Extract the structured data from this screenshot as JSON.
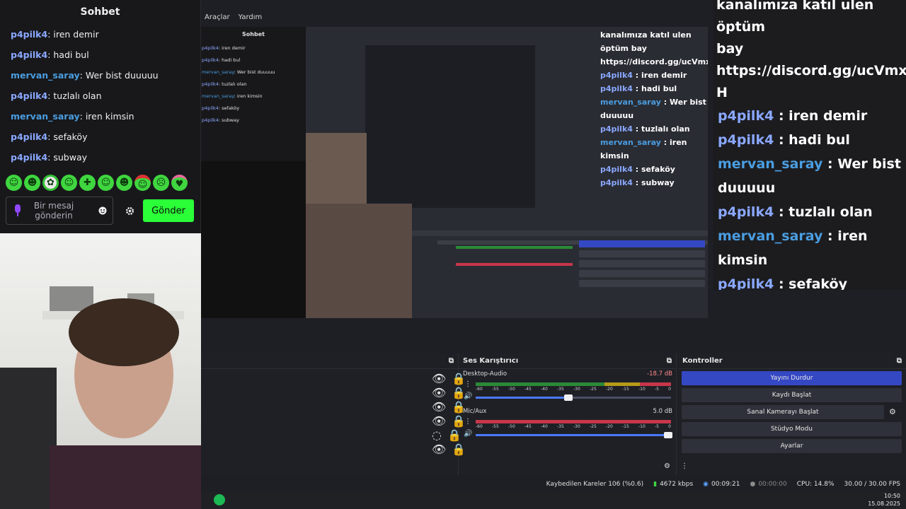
{
  "chat": {
    "title": "Sohbet",
    "user_colors": {
      "p4pilk4": "#8aa8ff",
      "mervan_saray": "#4a9de0"
    },
    "messages": [
      {
        "user": "p4pilk4",
        "text": "iren demir"
      },
      {
        "user": "p4pilk4",
        "text": "hadi bul"
      },
      {
        "user": "mervan_saray",
        "text": "Wer bist duuuuu"
      },
      {
        "user": "p4pilk4",
        "text": "tuzlalı olan"
      },
      {
        "user": "mervan_saray",
        "text": "iren kimsin"
      },
      {
        "user": "p4pilk4",
        "text": "sefaköy"
      },
      {
        "user": "p4pilk4",
        "text": "subway"
      }
    ],
    "placeholder": "Bir mesaj gönderin",
    "send_label": "Gönder",
    "accent": "#2bff38"
  },
  "menubar": {
    "items": [
      "Araçlar",
      "Yardım"
    ]
  },
  "preview": {
    "chat_title": "Sohbet",
    "overlay_intro": "kanalımıza katıl ulen öptüm bay https://discord.gg/ucVmxvhH"
  },
  "overlay": {
    "intro_lines": [
      "kanalımıza katıl ulen öptüm",
      "bay",
      "https://discord.gg/ucVmxvh",
      "H"
    ],
    "messages": [
      {
        "user": "p4pilk4",
        "text": ": iren demir"
      },
      {
        "user": "p4pilk4",
        "text": ": hadi bul"
      },
      {
        "user": "mervan_saray",
        "text": ": Wer bist duuuuu"
      },
      {
        "user": "p4pilk4",
        "text": ": tuzlalı olan"
      },
      {
        "user": "mervan_saray",
        "text": ": iren kimsin"
      },
      {
        "user": "p4pilk4",
        "text": ": sefaköy"
      },
      {
        "user": "p4pilk4",
        "text": ": subway"
      }
    ]
  },
  "mixer": {
    "title": "Ses Karıştırıcı",
    "scale": [
      "-60",
      "-55",
      "-50",
      "-45",
      "-40",
      "-35",
      "-30",
      "-25",
      "-20",
      "-15",
      "-10",
      "-5",
      "0"
    ],
    "tracks": [
      {
        "name": "Desktop-Audio",
        "db": "-18.7 dB",
        "fader_level": 0.49
      },
      {
        "name": "Mic/Aux",
        "db": "5.0 dB",
        "fader_level": 1.0
      }
    ]
  },
  "controls": {
    "title": "Kontroller",
    "buttons": [
      "Yayını Durdur",
      "Kaydı Başlat",
      "Sanal Kamerayı Başlat",
      "Stüdyo Modu",
      "Ayarlar"
    ]
  },
  "status": {
    "dropped": "Kaybedilen Kareler 106 (%0.6)",
    "bitrate": "4672 kbps",
    "stream_time": "00:09:21",
    "rec_time": "00:00:00",
    "cpu": "CPU: 14.8%",
    "fps": "30.00 / 30.00 FPS"
  },
  "clock": {
    "time": "10:50",
    "date": "15.08.2025"
  }
}
